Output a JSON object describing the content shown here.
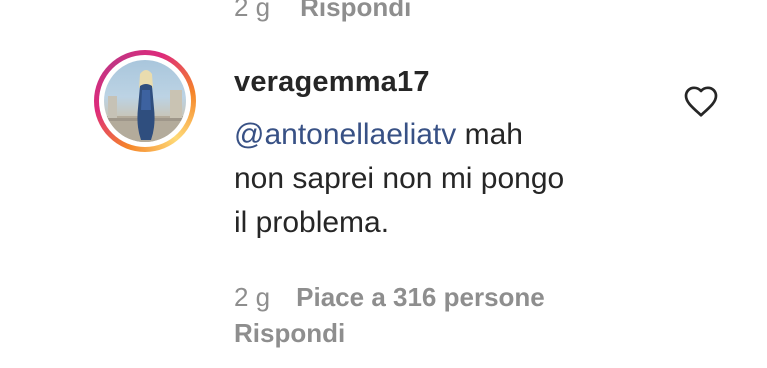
{
  "previous_comment": {
    "time": "2 g",
    "reply_label": "Rispondi"
  },
  "comment": {
    "username": "veragemma17",
    "mention": "@antonellaeliatv",
    "text_line1_rest": " mah",
    "text_line2": "non saprei non mi pongo",
    "text_line3": "il problema.",
    "time": "2 g",
    "likes_label": "Piace a 316 persone",
    "reply_label": "Rispondi",
    "liked": false
  },
  "icons": {
    "like": "heart-outline-icon",
    "avatar_ring_colors": [
      "#f58529",
      "#dd2a7b",
      "#c13584",
      "#feda77"
    ]
  },
  "colors": {
    "text": "#262626",
    "muted": "#8e8e8e",
    "mention": "#385185"
  }
}
